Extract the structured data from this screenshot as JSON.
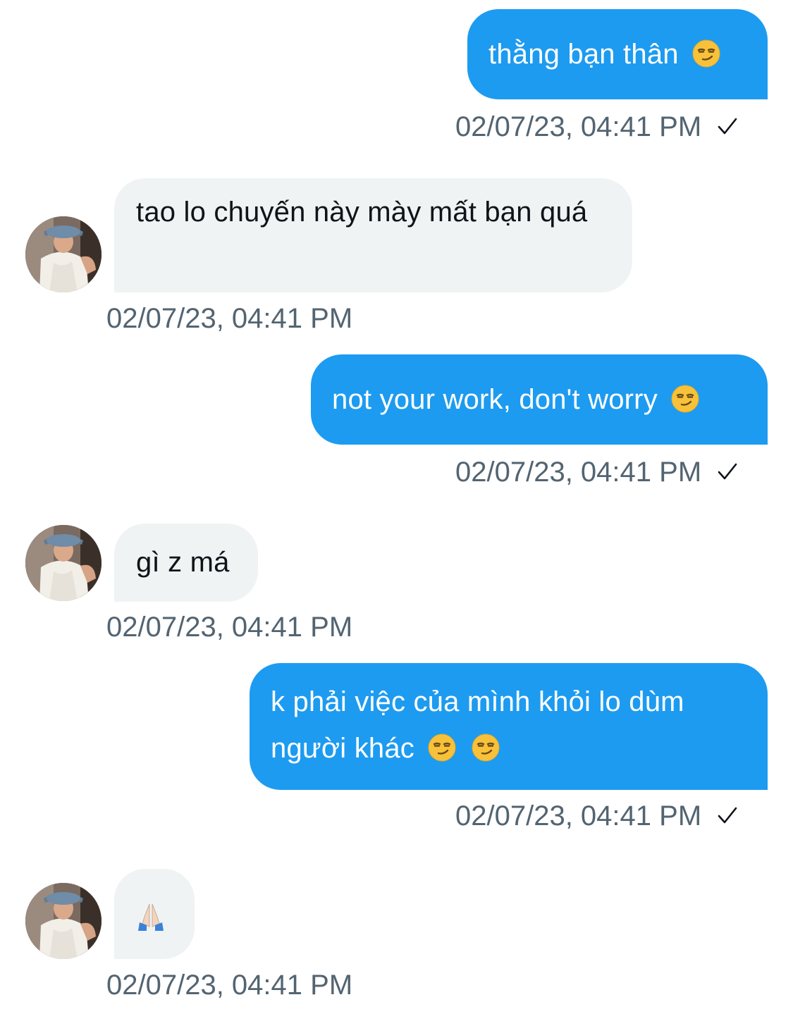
{
  "messages": [
    {
      "direction": "outgoing",
      "text": "thằng bạn thân",
      "emoji": [
        "smirking-face"
      ],
      "timestamp": "02/07/23, 04:41 PM",
      "status": "sent-check"
    },
    {
      "direction": "incoming",
      "text": "tao lo chuyến này mày mất bạn quá",
      "timestamp": "02/07/23, 04:41 PM"
    },
    {
      "direction": "outgoing",
      "text": "not your work, don't worry",
      "emoji": [
        "smirking-face"
      ],
      "timestamp": "02/07/23, 04:41 PM",
      "status": "sent-check"
    },
    {
      "direction": "incoming",
      "text": "gì z má",
      "timestamp": "02/07/23, 04:41 PM"
    },
    {
      "direction": "outgoing",
      "text_line1": "k phải việc của mình khỏi lo dùm",
      "text_line2": "người khác",
      "emoji": [
        "smirking-face",
        "smirking-face"
      ],
      "timestamp": "02/07/23, 04:41 PM",
      "status": "sent-check"
    },
    {
      "direction": "incoming",
      "text": "",
      "emoji": [
        "folded-hands"
      ],
      "timestamp": "02/07/23, 04:41 PM"
    }
  ],
  "icons": {
    "read_receipt": "checkmark-icon",
    "smirk": "smirking-face-emoji",
    "pray": "folded-hands-emoji"
  },
  "colors": {
    "outgoing_bubble": "#1d9bf0",
    "incoming_bubble": "#eff3f4",
    "timestamp_text": "#536471",
    "incoming_text": "#0f1419"
  }
}
